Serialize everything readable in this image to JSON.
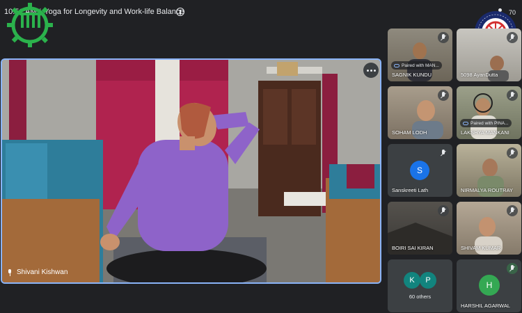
{
  "meeting": {
    "time": "10:51 AM",
    "separator": "|",
    "title": "Yoga for Longevity and Work-life Balance",
    "participant_count": "70"
  },
  "colors": {
    "active_border": "#8ab4f8",
    "background": "#202124",
    "tile_background": "#3c4043"
  },
  "main_speaker": {
    "name": "Shivani Kishwan"
  },
  "participants": [
    {
      "name": "SAGNIK KUNDU",
      "paired": "Paired with MAN...",
      "muted": true
    },
    {
      "name": "5098 AyanDutta",
      "muted": true
    },
    {
      "name": "SOHAM LODH",
      "muted": true
    },
    {
      "name": "LAKSHYA MANKANI",
      "paired": "Paired with PINA...",
      "muted": true
    },
    {
      "name": "Sanskreeti Lath",
      "initial": "S",
      "muted": true
    },
    {
      "name": "NIRMALYA ROUTRAY",
      "muted": true
    },
    {
      "name": "BOIRI SAI KIRAN",
      "muted": true
    },
    {
      "name": "SHIVAM KUMAR",
      "muted": true
    },
    {
      "others_initials": [
        "K",
        "P"
      ],
      "others_label": "60 others"
    },
    {
      "name": "HARSHIL AGARWAL",
      "initial": "H",
      "speaking": true
    }
  ]
}
